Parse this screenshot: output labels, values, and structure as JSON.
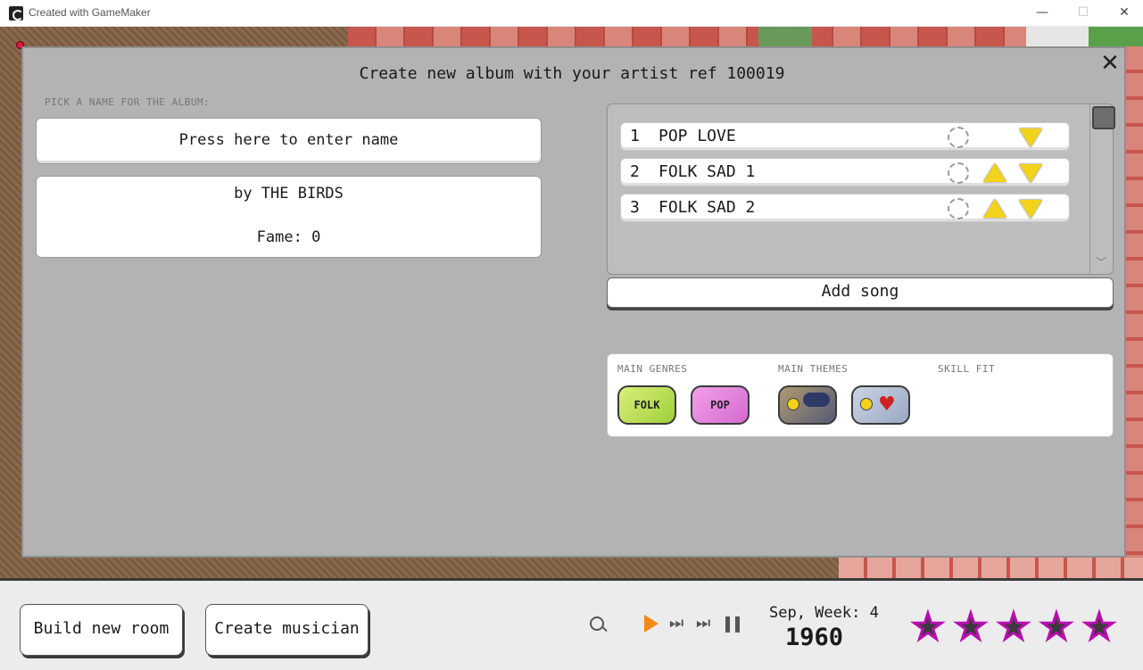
{
  "window": {
    "title": "Created with GameMaker",
    "minimize": "—",
    "maximize": "☐",
    "close": "✕"
  },
  "dialog": {
    "title": "Create new album with your artist ref 100019",
    "close": "✕",
    "pick_label": "PICK A NAME FOR THE ALBUM:",
    "name_placeholder": "Press here to enter name",
    "artist": "by THE BIRDS",
    "fame": "Fame: 0"
  },
  "songs": [
    {
      "num": "1",
      "name": "POP LOVE"
    },
    {
      "num": "2",
      "name": "FOLK SAD 1"
    },
    {
      "num": "3",
      "name": "FOLK SAD 2"
    }
  ],
  "add_song": "Add song",
  "info": {
    "genres_label": "MAIN GENRES",
    "themes_label": "MAIN THEMES",
    "skill_label": "SKILL FIT",
    "genres": [
      "FOLK",
      "POP"
    ]
  },
  "bottom": {
    "build_room": "Build new room",
    "create_musician": "Create musician",
    "date": "Sep, Week: 4",
    "year": "1960",
    "stars": [
      "★",
      "★",
      "★",
      "★",
      "★"
    ],
    "ff1": "⏭",
    "ff2": "⏭"
  },
  "colors": {
    "dialog_bg": "#b3b3b3",
    "triangle": "#f2d21a",
    "play": "#f08a1c",
    "star_outline": "#b80fb0"
  },
  "icons": [
    "search-icon",
    "play-icon",
    "fast-forward-icon",
    "faster-forward-icon",
    "pause-icon",
    "star-icon",
    "close-icon",
    "arrow-up-icon",
    "arrow-down-icon"
  ]
}
